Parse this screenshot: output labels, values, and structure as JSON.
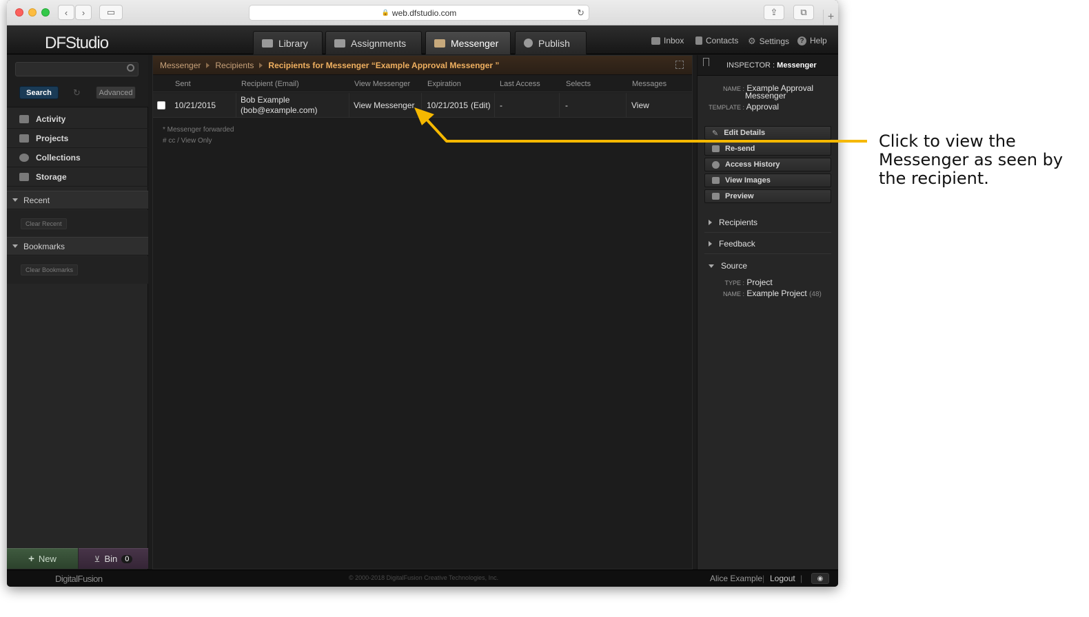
{
  "browser": {
    "url": "web.dfstudio.com"
  },
  "app": {
    "logo": "DFStudio",
    "tabs": [
      {
        "label": "Library"
      },
      {
        "label": "Assignments"
      },
      {
        "label": "Messenger"
      },
      {
        "label": "Publish"
      }
    ],
    "top_links": [
      {
        "label": "Inbox"
      },
      {
        "label": "Contacts"
      },
      {
        "label": "Settings"
      },
      {
        "label": "Help"
      }
    ]
  },
  "sidebar": {
    "search_placeholder": "",
    "search_button": "Search",
    "advanced_button": "Advanced",
    "nav": [
      {
        "label": "Activity"
      },
      {
        "label": "Projects"
      },
      {
        "label": "Collections"
      },
      {
        "label": "Storage"
      }
    ],
    "recent_label": "Recent",
    "clear_recent": "Clear Recent",
    "bookmarks_label": "Bookmarks",
    "clear_bookmarks": "Clear Bookmarks",
    "new_button": "New",
    "bin_button": "Bin",
    "bin_count": "0"
  },
  "main": {
    "breadcrumb": {
      "item1": "Messenger",
      "item2": "Recipients",
      "current": "Recipients for Messenger “Example Approval Messenger ”"
    },
    "columns": [
      "Sent",
      "Recipient (Email)",
      "View Messenger",
      "Expiration",
      "Last Access",
      "Selects",
      "Messages"
    ],
    "rows": [
      {
        "sent": "10/21/2015",
        "recipient_name": "Bob Example",
        "recipient_email": "(bob@example.com)",
        "view_messenger": "View Messenger",
        "expiration": "10/21/2015",
        "expiration_edit": "(Edit)",
        "last_access": "-",
        "selects": "-",
        "messages": "View"
      }
    ],
    "notes": [
      "* Messenger forwarded",
      "# cc / View Only"
    ]
  },
  "inspector": {
    "header_label": "INSPECTOR :",
    "header_value": "Messenger",
    "name_label": "NAME :",
    "name_value_line1": "Example Approval",
    "name_value_line2": "Messenger",
    "template_label": "TEMPLATE :",
    "template_value": "Approval",
    "actions": [
      {
        "label": "Edit Details"
      },
      {
        "label": "Re-send"
      },
      {
        "label": "Access History"
      },
      {
        "label": "View Images"
      },
      {
        "label": "Preview"
      }
    ],
    "sections": [
      {
        "label": "Recipients"
      },
      {
        "label": "Feedback"
      },
      {
        "label": "Source"
      }
    ],
    "source_type_label": "TYPE :",
    "source_type_value": "Project",
    "source_name_label": "NAME :",
    "source_name_value": "Example Project",
    "source_name_count": "(48)"
  },
  "footer": {
    "logo": "DigitalFusion",
    "copyright": "© 2000-2018 DigitalFusion Creative Technologies, Inc.",
    "user": "Alice Example",
    "logout": "Logout"
  },
  "annotation": {
    "text": "Click to view the Messenger as seen by the recipient.",
    "color": "#f5b800"
  }
}
